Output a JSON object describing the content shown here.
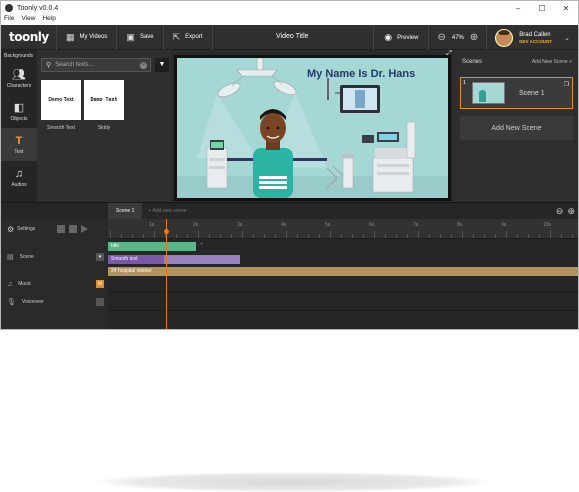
{
  "window": {
    "title": "Toonly v0.0.4",
    "controls": [
      "–",
      "☐",
      "✕"
    ]
  },
  "menu": [
    "File",
    "View",
    "Help"
  ],
  "toolbar": {
    "logo": "toonly",
    "my_videos": "My Videos",
    "save": "Save",
    "export": "Export",
    "video_title": "Video Title",
    "preview": "Preview",
    "zoom_level": "47%",
    "user_name": "Brad Callen",
    "user_role": "DEV ACCOUNT"
  },
  "left_nav": {
    "header": "Backgrounds",
    "items": [
      {
        "label": "Characters",
        "icon": "characters-icon"
      },
      {
        "label": "Objects",
        "icon": "objects-icon"
      },
      {
        "label": "Text",
        "icon": "text-icon",
        "active": true
      },
      {
        "label": "Audios",
        "icon": "audio-icon"
      }
    ]
  },
  "assets": {
    "search_placeholder": "Search texts...",
    "cards": [
      {
        "preview": "Demo  Text",
        "label": "Smooth Text"
      },
      {
        "preview": "Demo  Text",
        "label": "Sktdy"
      }
    ]
  },
  "stage": {
    "title": "My Name Is Dr. Hans",
    "colors": {
      "background": "#a5d7d5",
      "title": "#223a6a"
    }
  },
  "scenes": {
    "header": "Scenes",
    "add_link": "Add New Scene",
    "items": [
      {
        "number": "1",
        "label": "Scene 1"
      }
    ],
    "add_button": "Add New Scene"
  },
  "timeline": {
    "tabs": [
      "Scene 1"
    ],
    "add_tab": "+ Add new scene",
    "settings_label": "Settings",
    "tracks": [
      {
        "label": "Scene"
      },
      {
        "label": "Music",
        "button": "M"
      },
      {
        "label": "Voiceover",
        "button": ""
      }
    ],
    "ruler_labels": [
      "1s",
      "2s",
      "3s",
      "4s",
      "5s",
      "6s",
      "7s",
      "8s",
      "9s",
      "10s"
    ],
    "clips": {
      "idle": "Idle",
      "smooth_text": "Smooth text",
      "background": "24 hospital interior"
    },
    "colors": {
      "idle": "#5bb58a",
      "smooth_text": "#7a5aa8",
      "smooth_text_tail": "#9a80c0",
      "background": "#b5935d",
      "playhead": "#e37a18"
    }
  }
}
